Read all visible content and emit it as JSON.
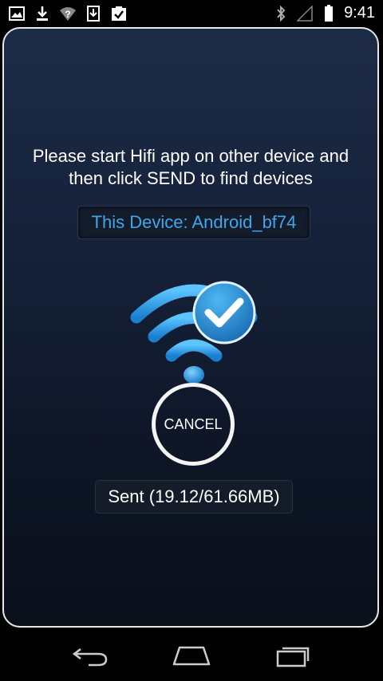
{
  "status_bar": {
    "time": "9:41",
    "icons": [
      "image-icon",
      "download-icon",
      "wifi-question-icon",
      "download-box-icon",
      "clipboard-check-icon",
      "bluetooth-icon",
      "signal-icon",
      "battery-icon"
    ]
  },
  "dialog": {
    "message": "Please start Hifi app on other device and then click SEND to find devices",
    "device_label": "This Device: Android_bf74",
    "cancel_label": "CANCEL",
    "sent_status": "Sent (19.12/61.66MB)"
  },
  "navigation": {
    "buttons": [
      "back-icon",
      "home-icon",
      "recents-icon"
    ]
  },
  "colors": {
    "accent": "#3fa6e8",
    "panel_top": "#1c2b47",
    "panel_bottom": "#0a0f1a"
  }
}
